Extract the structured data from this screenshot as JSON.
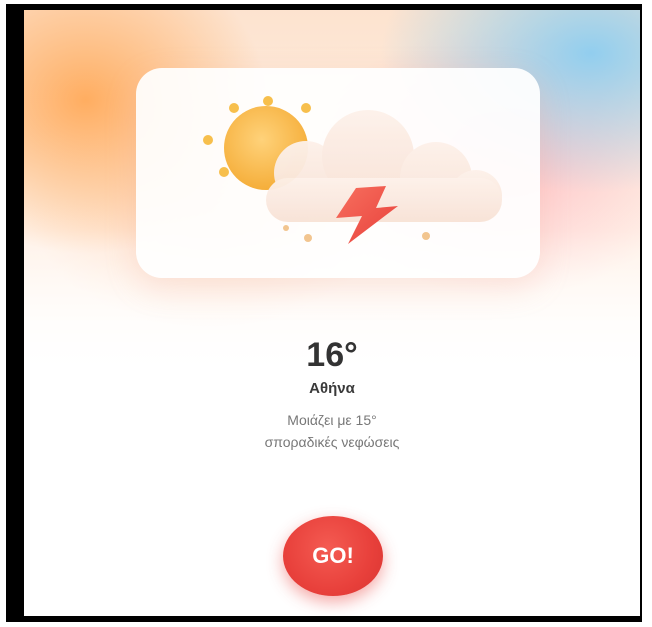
{
  "weather": {
    "temperature": "16°",
    "city": "Αθήνα",
    "feels_like": "Μοιάζει με 15°",
    "condition": "σποραδικές νεφώσεις",
    "icon": "sun-cloud-lightning-icon"
  },
  "actions": {
    "go_label": "GO!"
  },
  "colors": {
    "go_button": "#e8403b",
    "sun": "#f7b640",
    "lightning": "#f0584c",
    "cloud": "#fbe9df"
  }
}
